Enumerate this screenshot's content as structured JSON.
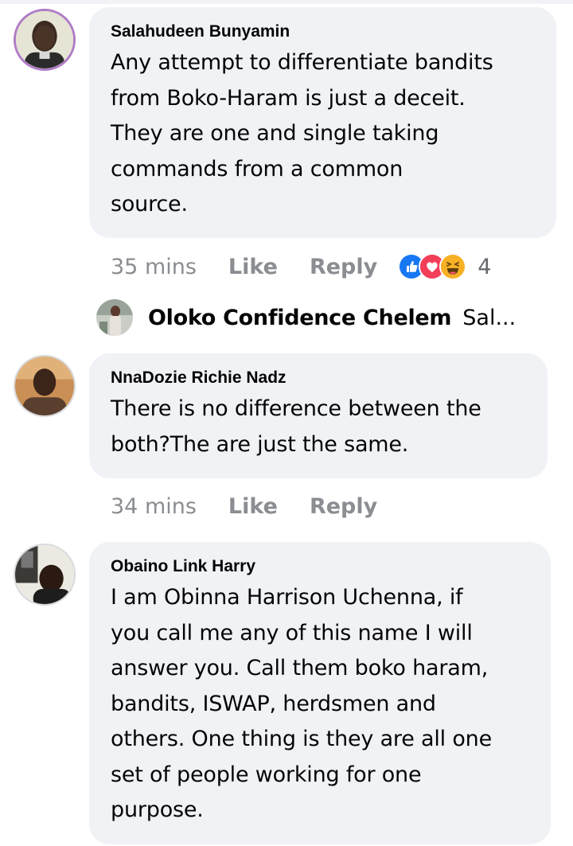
{
  "comments": [
    {
      "author": "Salahudeen Bunyamin",
      "lines": [
        "Any attempt to differentiate bandits",
        "from Boko-Haram is just a deceit.",
        "They are one and single taking",
        "commands from a common",
        "source."
      ],
      "time": "35 mins",
      "like_label": "Like",
      "reply_label": "Reply",
      "reaction_icons": [
        "like-reaction",
        "love-reaction",
        "haha-reaction"
      ],
      "reaction_count": "4",
      "reply_preview": {
        "name": "Oloko Confidence Chelem",
        "snippet": "Sal..."
      }
    },
    {
      "author": "NnaDozie Richie Nadz",
      "lines": [
        "There is no difference between the",
        "both?The are just the same."
      ],
      "time": "34 mins",
      "like_label": "Like",
      "reply_label": "Reply"
    },
    {
      "author": "Obaino Link Harry",
      "lines": [
        "I am Obinna Harrison Uchenna, if",
        "you call me any of this name I will",
        "answer you. Call them boko haram,",
        "bandits, ISWAP, herdsmen and",
        "others. One thing is they are all one",
        "set of people working for one",
        "purpose."
      ]
    }
  ],
  "colors": {
    "bubble": "#f0f2f5",
    "meta_text": "#8a8d91",
    "like_blue": "#1877f2",
    "love_red": "#f33e58",
    "haha_yellow": "#f7b125"
  }
}
